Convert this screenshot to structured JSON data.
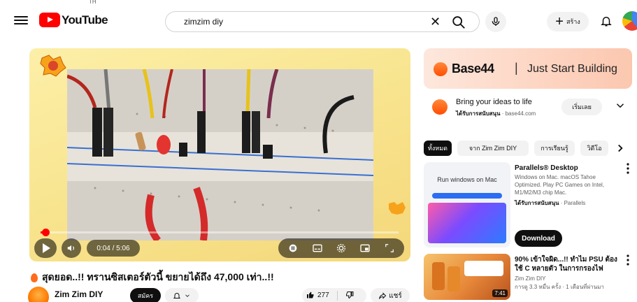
{
  "header": {
    "logo_text": "YouTube",
    "country_code": "TH",
    "search_value": "zimzim diy",
    "create_label": "สร้าง",
    "icons": [
      "menu-icon",
      "search-icon",
      "mic-icon",
      "plus-icon",
      "bell-icon",
      "clear-icon"
    ]
  },
  "player": {
    "time": "0:04 / 5:06",
    "progress": 0.013,
    "accent_color": "#ff0000"
  },
  "video": {
    "title": "สุดยอด..!! ทรานซิสเตอร์ตัวนี้ ขยายได้ถึง 47,000 เท่า..!!",
    "channel_name": "Zim Zim DIY",
    "subscribe_label": "สมัคร",
    "like_count": "277",
    "share_label": "แชร์"
  },
  "ad": {
    "brand": "Base44",
    "tagline": "Just Start Building",
    "info_title": "Bring your ideas to life",
    "sponsor_label": "ได้รับการสนับสนุน",
    "sponsor_domain": "base44.com",
    "cta_label": "เริ่มเลย"
  },
  "chips": [
    {
      "label": "ทั้งหมด",
      "active": true
    },
    {
      "label": "จาก Zim Zim DIY",
      "active": false
    },
    {
      "label": "การเรียนรู้",
      "active": false
    },
    {
      "label": "วิดีโอ",
      "active": false
    }
  ],
  "recs": [
    {
      "title": "Parallels® Desktop",
      "description": "Windows on Mac. macOS Tahoe Optimized. Play PC Games on Intel, M1/M2/M3 chip Mac.",
      "sponsor_label": "ได้รับการสนับสนุน",
      "sponsor_name": "Parallels",
      "thumb_text": "Run windows on Mac",
      "cta_label": "Download"
    },
    {
      "title": "90% เข้าใจผิด...!! ทำไม PSU ต้องใช้ C หลายตัว ในการกรองไฟ",
      "channel": "Zim Zim DIY",
      "meta": "การดู 3.3 หมื่น ครั้ง · 1 เดือนที่ผ่านมา",
      "duration": "7:41"
    }
  ]
}
